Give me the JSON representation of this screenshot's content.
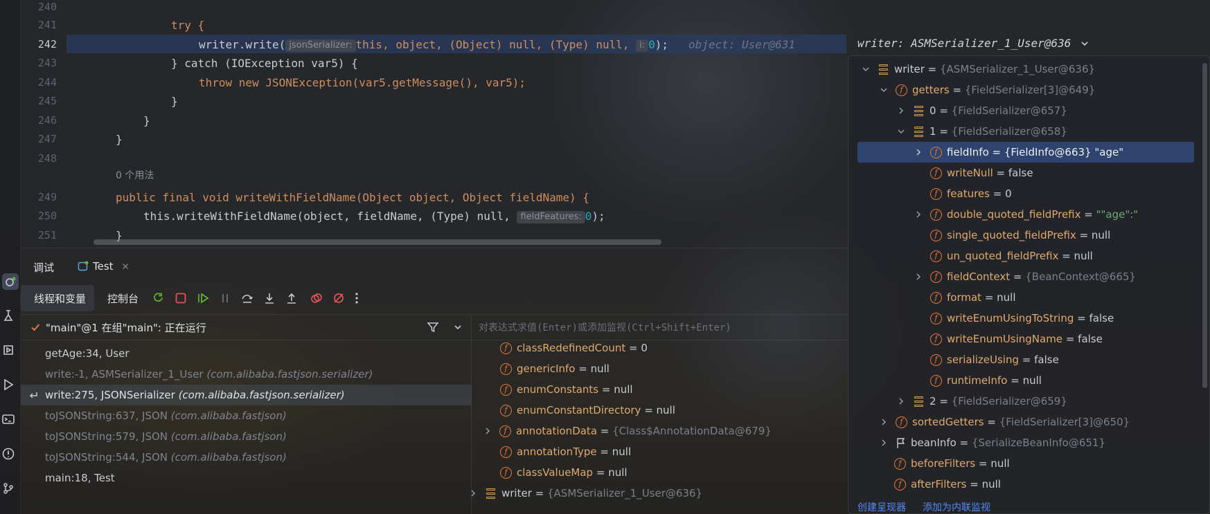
{
  "editor": {
    "line_numbers": [
      "240",
      "241",
      "242",
      "243",
      "244",
      "245",
      "246",
      "247",
      "248",
      "249",
      "250",
      "251"
    ],
    "line_241": "try {",
    "line_242": {
      "call": "writer.write(",
      "hint_label": "jsonSerializer:",
      "args": "this, object, (Object) null, (Type) null,",
      "hint_i": "i:",
      "arg_zero": "0",
      "end": ");",
      "inline_value": "object: User@631"
    },
    "line_243": "} catch (IOException var5) {",
    "line_244": "throw new JSONException(var5.getMessage(), var5);",
    "line_245": "}",
    "line_246": "}",
    "line_247": "}",
    "usages": "0 个用法",
    "line_249": "public final void writeWithFieldName(Object object, Object fieldName) {",
    "line_250": {
      "code": "this.writeWithFieldName(object, fieldName, (Type) null,",
      "hint_label": "fieldFeatures:",
      "arg_zero": "0",
      "end": ");"
    },
    "line_251": "}",
    "writer_header": "writer: ASMSerializer_1_User@636"
  },
  "debug": {
    "tab_debug": "调试",
    "tab_config": "Test",
    "subtab_threads": "线程和变量",
    "subtab_console": "控制台",
    "thread_status": "\"main\"@1 在组\"main\": 正在运行",
    "expression_placeholder": "对表达式求值(Enter)或添加监视(Ctrl+Shift+Enter)",
    "frames": [
      {
        "method": "getAge:34, User",
        "pkg": ""
      },
      {
        "method": "write:-1, ASMSerializer_1_User",
        "pkg": "(com.alibaba.fastjson.serializer)"
      },
      {
        "method": "write:275, JSONSerializer",
        "pkg": "(com.alibaba.fastjson.serializer)"
      },
      {
        "method": "toJSONString:637, JSON",
        "pkg": "(com.alibaba.fastjson)"
      },
      {
        "method": "toJSONString:579, JSON",
        "pkg": "(com.alibaba.fastjson)"
      },
      {
        "method": "toJSONString:544, JSON",
        "pkg": "(com.alibaba.fastjson)"
      },
      {
        "method": "main:18, Test",
        "pkg": ""
      }
    ],
    "variables": [
      {
        "name": "classRedefinedCount",
        "value": "0",
        "ref": ""
      },
      {
        "name": "genericInfo",
        "value": "null",
        "ref": ""
      },
      {
        "name": "enumConstants",
        "value": "null",
        "ref": ""
      },
      {
        "name": "enumConstantDirectory",
        "value": "null",
        "ref": ""
      },
      {
        "name": "annotationData",
        "value": "",
        "ref": "{Class$AnnotationData@679}"
      },
      {
        "name": "annotationType",
        "value": "null",
        "ref": ""
      },
      {
        "name": "classValueMap",
        "value": "null",
        "ref": ""
      },
      {
        "name": "writer",
        "value": "",
        "ref": "{ASMSerializer_1_User@636}"
      }
    ]
  },
  "popup": {
    "rows": [
      {
        "name": "writer",
        "ref": "{ASMSerializer_1_User@636}",
        "value": ""
      },
      {
        "name": "getters",
        "ref": "{FieldSerializer[3]@649}",
        "value": ""
      },
      {
        "name": "0",
        "ref": "{FieldSerializer@657}",
        "value": ""
      },
      {
        "name": "1",
        "ref": "{FieldSerializer@658}",
        "value": ""
      },
      {
        "name": "fieldInfo",
        "ref": "{FieldInfo@663}",
        "value": "\"age\""
      },
      {
        "name": "writeNull",
        "ref": "",
        "value": "false"
      },
      {
        "name": "features",
        "ref": "",
        "value": "0"
      },
      {
        "name": "double_quoted_fieldPrefix",
        "ref": "",
        "value": "\"\"age\":\""
      },
      {
        "name": "single_quoted_fieldPrefix",
        "ref": "",
        "value": "null"
      },
      {
        "name": "un_quoted_fieldPrefix",
        "ref": "",
        "value": "null"
      },
      {
        "name": "fieldContext",
        "ref": "{BeanContext@665}",
        "value": ""
      },
      {
        "name": "format",
        "ref": "",
        "value": "null"
      },
      {
        "name": "writeEnumUsingToString",
        "ref": "",
        "value": "false"
      },
      {
        "name": "writeEnumUsingName",
        "ref": "",
        "value": "false"
      },
      {
        "name": "serializeUsing",
        "ref": "",
        "value": "false"
      },
      {
        "name": "runtimeInfo",
        "ref": "",
        "value": "null"
      },
      {
        "name": "2",
        "ref": "{FieldSerializer@659}",
        "value": ""
      },
      {
        "name": "sortedGetters",
        "ref": "{FieldSerializer[3]@650}",
        "value": ""
      },
      {
        "name": "beanInfo",
        "ref": "{SerializeBeanInfo@651}",
        "value": ""
      },
      {
        "name": "beforeFilters",
        "ref": "",
        "value": "null"
      },
      {
        "name": "afterFilters",
        "ref": "",
        "value": "null"
      }
    ],
    "link_create_renderer": "创建呈现器",
    "link_add_watch": "添加为内联监视"
  },
  "colors": {
    "accent": "#548af7",
    "field_name": "#e0aa6e",
    "keyword": "#cf8e5e",
    "method": "#56a8f5",
    "number": "#2aacb8",
    "selection": "#2e436e"
  }
}
